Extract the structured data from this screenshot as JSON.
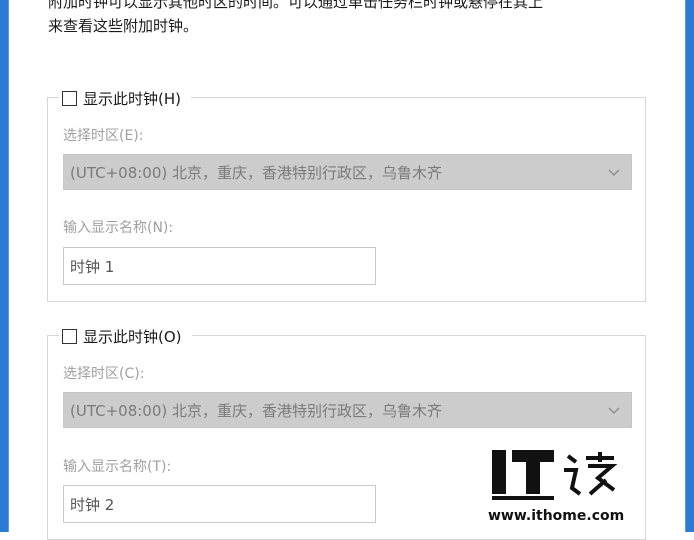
{
  "description": {
    "line1": "附加时钟可以显示其他时区的时间。可以通过单击任务栏时钟或悬停在其上",
    "line2": "来查看这些附加时钟。"
  },
  "clock1": {
    "show_label": "显示此时钟(H)",
    "checked": false,
    "timezone_label": "选择时区(E):",
    "timezone_value": "(UTC+08:00) 北京，重庆，香港特别行政区，乌鲁木齐",
    "name_label": "输入显示名称(N):",
    "name_value": "时钟 1"
  },
  "clock2": {
    "show_label": "显示此时钟(O)",
    "checked": false,
    "timezone_label": "选择时区(C):",
    "timezone_value": "(UTC+08:00) 北京，重庆，香港特别行政区，乌鲁木齐",
    "name_label": "输入显示名称(T):",
    "name_value": "时钟 2"
  },
  "watermark": {
    "logo_text": "IT之家",
    "url": "www.ithome.com"
  },
  "colors": {
    "window_frame": "#2b7bd6",
    "disabled_select": "#cccccc",
    "disabled_text": "#a0a0a0"
  }
}
